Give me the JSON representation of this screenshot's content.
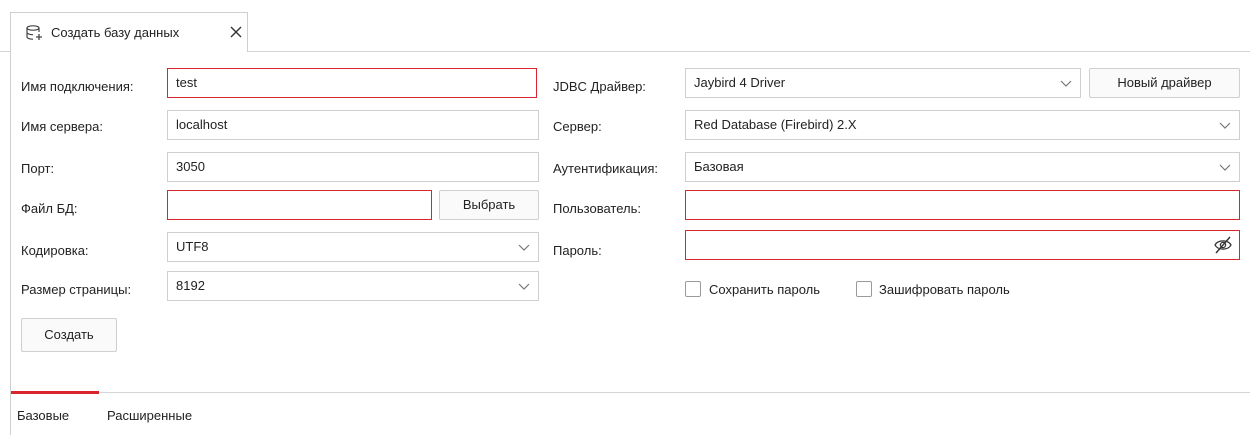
{
  "tab": {
    "title": "Создать базу данных",
    "icon": "database-add-icon",
    "close_icon": "close-icon"
  },
  "left": {
    "connection_name": {
      "label": "Имя подключения:",
      "value": "test"
    },
    "server_name": {
      "label": "Имя сервера:",
      "value": "localhost"
    },
    "port": {
      "label": "Порт:",
      "value": "3050"
    },
    "db_file": {
      "label": "Файл БД:",
      "value": "",
      "button": "Выбрать"
    },
    "encoding": {
      "label": "Кодировка:",
      "value": "UTF8"
    },
    "page_size": {
      "label": "Размер страницы:",
      "value": "8192"
    },
    "create_button": "Создать"
  },
  "right": {
    "jdbc_driver": {
      "label": "JDBC Драйвер:",
      "value": "Jaybird 4 Driver",
      "button": "Новый драйвер"
    },
    "server": {
      "label": "Сервер:",
      "value": "Red Database (Firebird) 2.X"
    },
    "auth": {
      "label": "Аутентификация:",
      "value": "Базовая"
    },
    "user": {
      "label": "Пользователь:",
      "value": ""
    },
    "password": {
      "label": "Пароль:",
      "value": ""
    },
    "save_password": {
      "label": "Сохранить пароль",
      "checked": false
    },
    "encrypt_password": {
      "label": "Зашифровать пароль",
      "checked": false
    }
  },
  "bottom_tabs": [
    {
      "label": "Базовые",
      "active": true
    },
    {
      "label": "Расширенные",
      "active": false
    }
  ],
  "colors": {
    "error_border": "#d9252e",
    "border": "#cfcfcf",
    "accent": "#d9252e"
  }
}
